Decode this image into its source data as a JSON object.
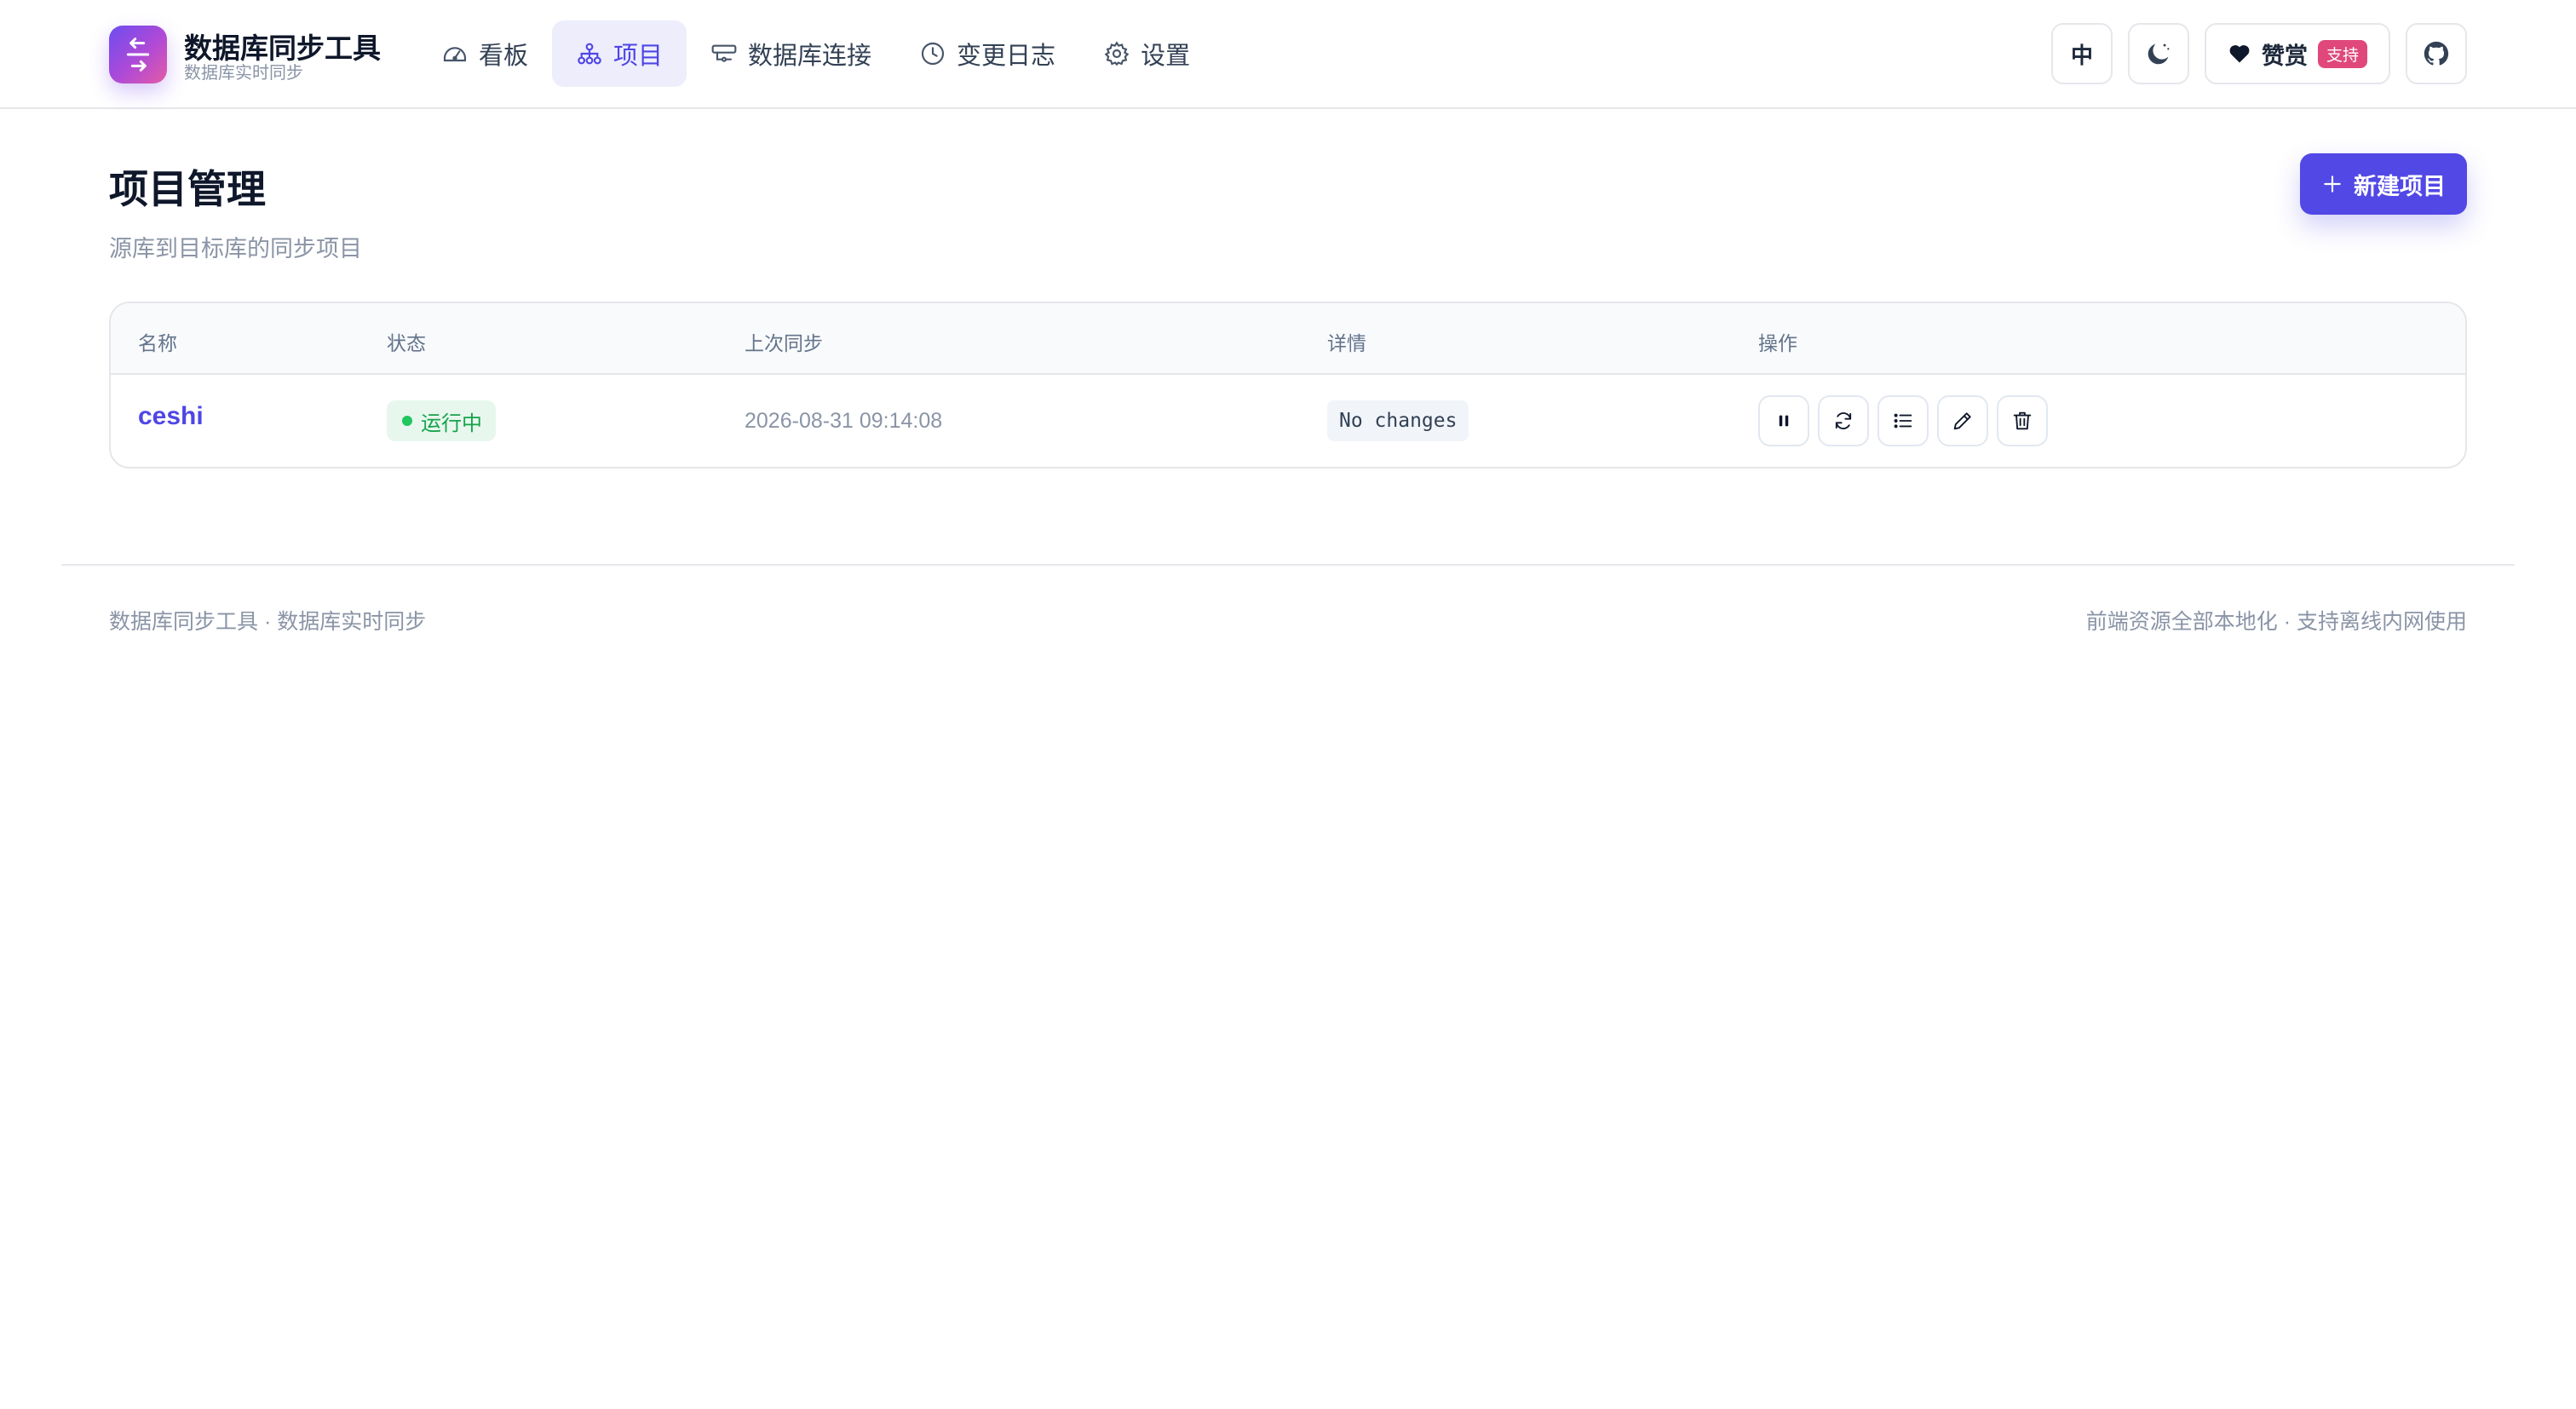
{
  "app": {
    "title": "数据库同步工具",
    "subtitle": "数据库实时同步"
  },
  "nav": {
    "items": [
      {
        "label": "看板",
        "icon": "dashboard-icon",
        "active": false
      },
      {
        "label": "项目",
        "icon": "project-icon",
        "active": true
      },
      {
        "label": "数据库连接",
        "icon": "database-connection-icon",
        "active": false
      },
      {
        "label": "变更日志",
        "icon": "clock-icon",
        "active": false
      },
      {
        "label": "设置",
        "icon": "gear-icon",
        "active": false
      }
    ]
  },
  "header_actions": {
    "language_label": "中",
    "theme_icon": "moon-icon",
    "tip_label": "赞赏",
    "tip_badge": "支持",
    "github_icon": "github-icon"
  },
  "page": {
    "title": "项目管理",
    "subtitle": "源库到目标库的同步项目",
    "new_button_label": "新建项目"
  },
  "table": {
    "columns": [
      "名称",
      "状态",
      "上次同步",
      "详情",
      "操作"
    ],
    "rows": [
      {
        "name": "ceshi",
        "status": "运行中",
        "last_sync": "2026-08-31 09:14:08",
        "detail": "No changes",
        "actions": [
          "pause-icon",
          "refresh-icon",
          "list-icon",
          "edit-icon",
          "trash-icon"
        ]
      }
    ]
  },
  "footer": {
    "left": "数据库同步工具 · 数据库实时同步",
    "right": "前端资源全部本地化 · 支持离线内网使用"
  },
  "colors": {
    "accent": "#4f46e5",
    "status_running": "#16a34a",
    "tip_badge": "#e0487c"
  }
}
